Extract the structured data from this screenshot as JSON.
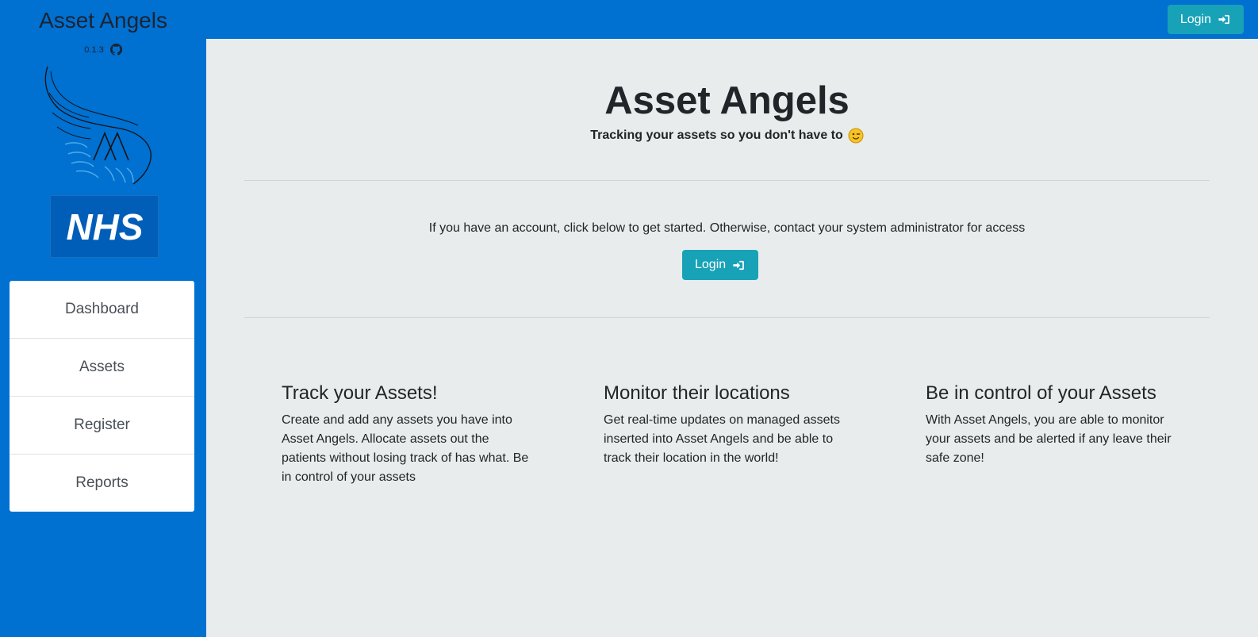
{
  "header": {
    "login_label": "Login"
  },
  "sidebar": {
    "title": "Asset Angels",
    "version": "0.1.3",
    "logo_text": "NHS",
    "nav": [
      {
        "label": "Dashboard"
      },
      {
        "label": "Assets"
      },
      {
        "label": "Register"
      },
      {
        "label": "Reports"
      }
    ]
  },
  "main": {
    "title": "Asset Angels",
    "subtitle": "Tracking your assets so you don't have to",
    "info": "If you have an account, click below to get started. Otherwise, contact your system administrator for access",
    "login_label": "Login",
    "features": [
      {
        "title": "Track your Assets!",
        "text": "Create and add any assets you have into Asset Angels. Allocate assets out the patients without losing track of has what. Be in control of your assets"
      },
      {
        "title": "Monitor their locations",
        "text": "Get real-time updates on managed assets inserted into Asset Angels and be able to track their location in the world!"
      },
      {
        "title": "Be in control of your Assets",
        "text": "With Asset Angels, you are able to monitor your assets and be alerted if any leave their safe zone!"
      }
    ]
  },
  "colors": {
    "brand_blue": "#0070d1",
    "button_teal": "#17a2b8",
    "content_bg": "#e8ecec",
    "nhs_blue": "#005eb8"
  }
}
